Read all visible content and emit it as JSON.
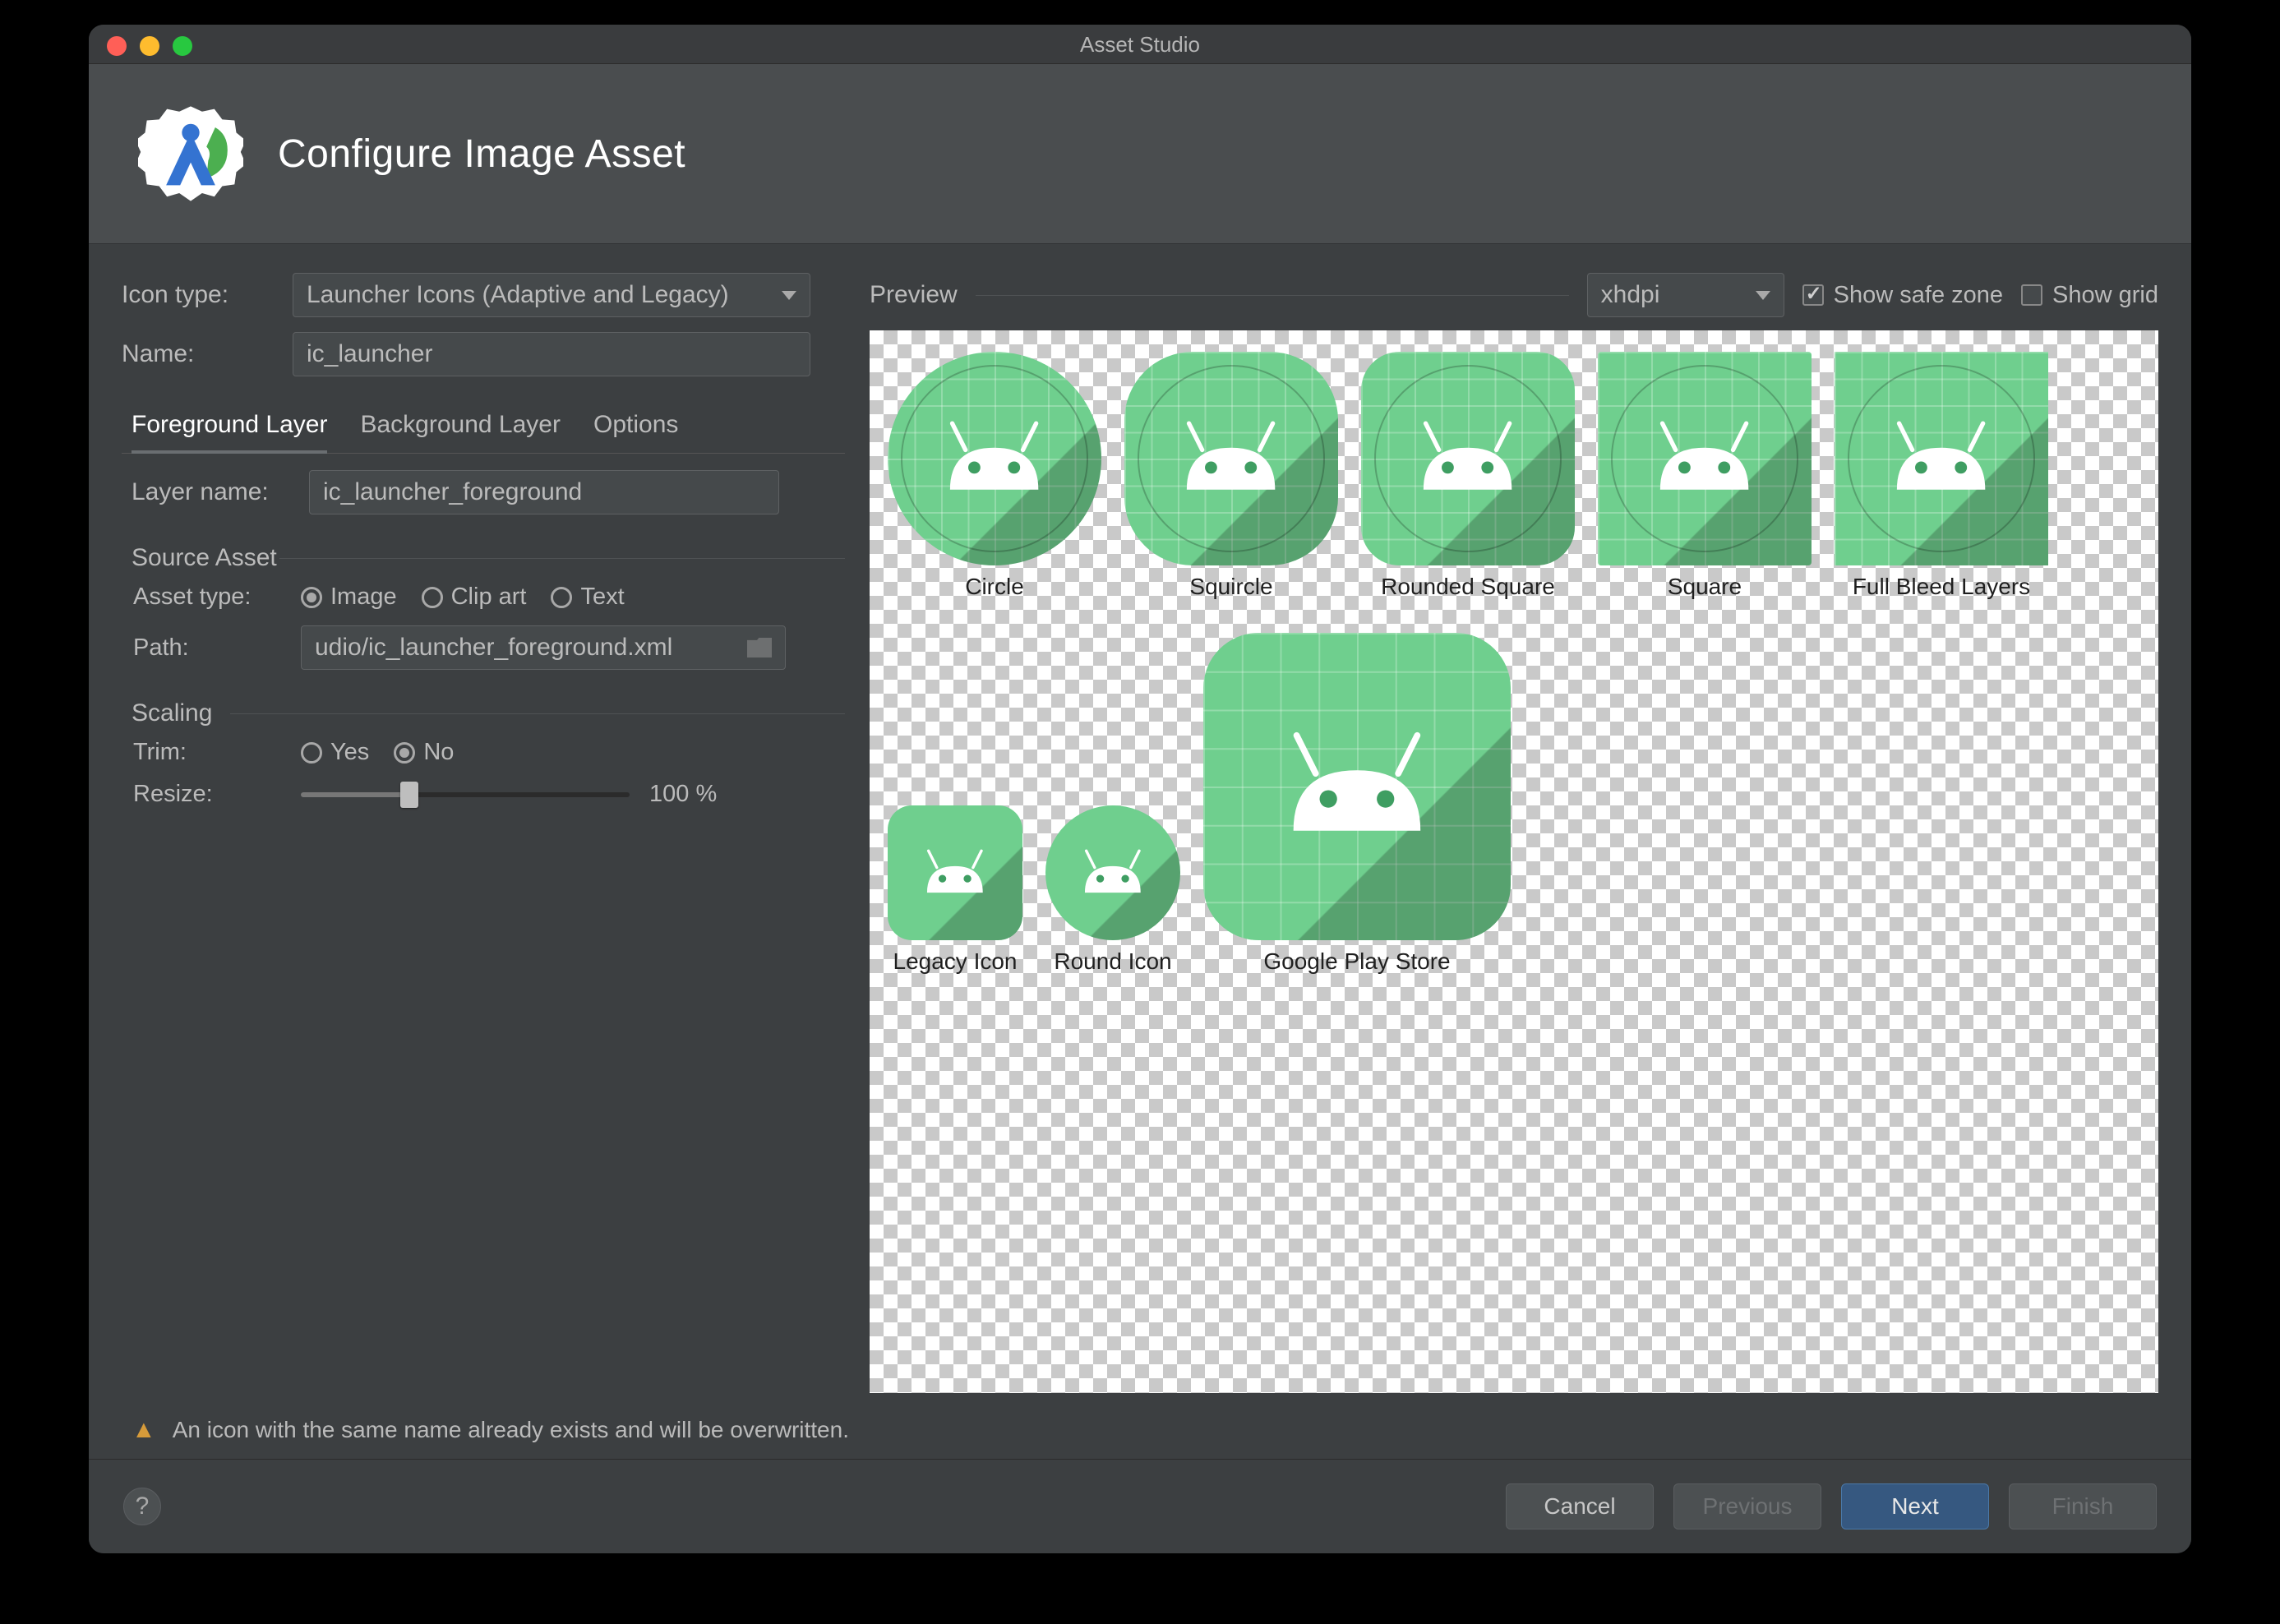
{
  "window": {
    "title": "Asset Studio"
  },
  "banner": {
    "title": "Configure Image Asset"
  },
  "left": {
    "icon_type_label": "Icon type:",
    "icon_type_value": "Launcher Icons (Adaptive and Legacy)",
    "name_label": "Name:",
    "name_value": "ic_launcher",
    "tabs": {
      "foreground": "Foreground Layer",
      "background": "Background Layer",
      "options": "Options"
    },
    "layer_name_label": "Layer name:",
    "layer_name_value": "ic_launcher_foreground",
    "source_asset_title": "Source Asset",
    "asset_type_label": "Asset type:",
    "asset_type": {
      "image": "Image",
      "clipart": "Clip art",
      "text": "Text"
    },
    "path_label": "Path:",
    "path_value": "udio/ic_launcher_foreground.xml",
    "scaling_title": "Scaling",
    "trim_label": "Trim:",
    "trim": {
      "yes": "Yes",
      "no": "No"
    },
    "resize_label": "Resize:",
    "resize_value": "100 %",
    "resize_percent": 33
  },
  "preview": {
    "label": "Preview",
    "density": "xhdpi",
    "show_safe_zone_label": "Show safe zone",
    "show_safe_zone": true,
    "show_grid_label": "Show grid",
    "show_grid": false,
    "items_row1": [
      {
        "label": "Circle",
        "shape": "circle"
      },
      {
        "label": "Squircle",
        "shape": "squircle"
      },
      {
        "label": "Rounded Square",
        "shape": "rsquare"
      },
      {
        "label": "Square",
        "shape": "square"
      },
      {
        "label": "Full Bleed Layers",
        "shape": "bleed"
      }
    ],
    "legacy_label": "Legacy Icon",
    "round_label": "Round Icon",
    "play_label": "Google Play Store"
  },
  "warning": "An icon with the same name already exists and will be overwritten.",
  "buttons": {
    "help": "?",
    "cancel": "Cancel",
    "previous": "Previous",
    "next": "Next",
    "finish": "Finish"
  },
  "colors": {
    "android_green": "#6FCF8E",
    "primary_blue": "#365880"
  }
}
